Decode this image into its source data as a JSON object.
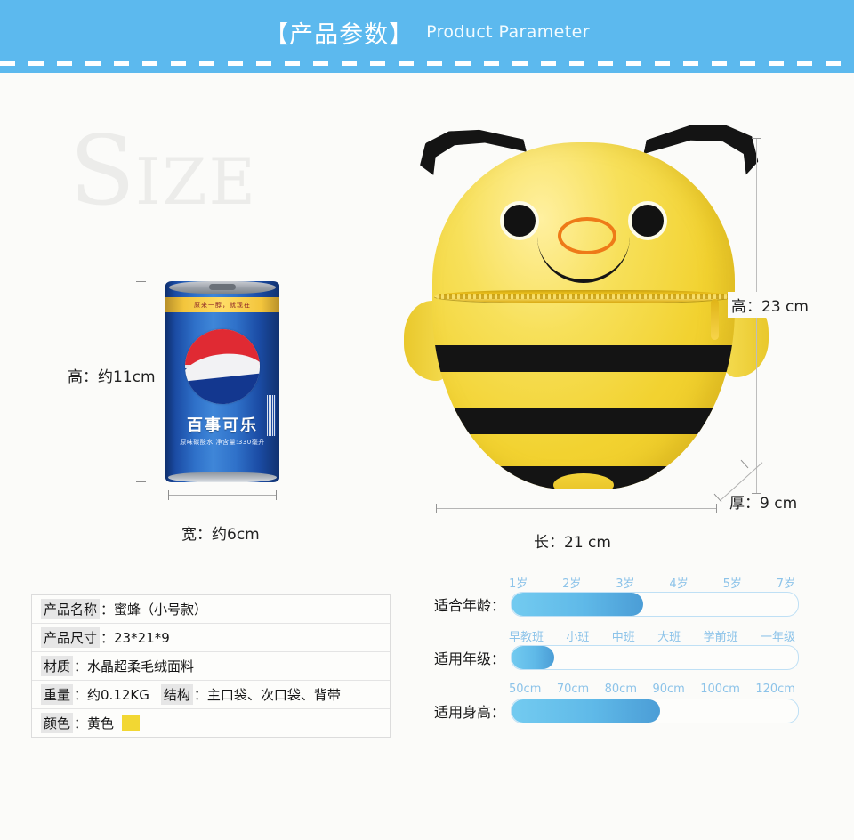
{
  "header": {
    "title_cn": "【产品参数】",
    "title_en": "Product Parameter",
    "bg_color": "#5cb9ee"
  },
  "watermark": {
    "big": "S",
    "small": "IZE"
  },
  "can": {
    "brand_cn": "百事可乐",
    "band_text": "原来一醇，就现在",
    "sub_text": "原味碳酸水  净含量:330毫升",
    "height_label": "高：约11cm",
    "width_label": "宽：约6cm"
  },
  "backpack": {
    "height_label": "高：23 cm",
    "length_label": "长：21 cm",
    "depth_label": "厚：9 cm",
    "body_color": "#f2d230",
    "stripe_color": "#141414",
    "nose_color": "#ee7a18"
  },
  "spec_table": {
    "rows": [
      {
        "label": "产品名称",
        "value": "：蜜蜂（小号款）"
      },
      {
        "label": "产品尺寸",
        "value": "：23*21*9"
      },
      {
        "label": "材质",
        "value": "：水晶超柔毛绒面料"
      },
      {
        "label": "重量",
        "value": "：约0.12KG",
        "label2": "结构",
        "value2": "：主口袋、次口袋、背带"
      },
      {
        "label": "颜色",
        "value": "：黄色",
        "swatch_color": "#f2d733"
      }
    ]
  },
  "sliders": [
    {
      "label": "适合年龄：",
      "ticks": [
        "1岁",
        "2岁",
        "3岁",
        "4岁",
        "5岁",
        "7岁"
      ],
      "fill_percent": 46
    },
    {
      "label": "适用年级：",
      "ticks": [
        "早教班",
        "小班",
        "中班",
        "大班",
        "学前班",
        "一年级"
      ],
      "fill_percent": 15
    },
    {
      "label": "适用身高：",
      "ticks": [
        "50cm",
        "70cm",
        "80cm",
        "90cm",
        "100cm",
        "120cm"
      ],
      "fill_percent": 52
    }
  ],
  "colors": {
    "accent": "#5cb9ee",
    "tick_text": "#8cc3e9",
    "fill_start": "#73cbf0",
    "fill_end": "#4b9dd6"
  }
}
